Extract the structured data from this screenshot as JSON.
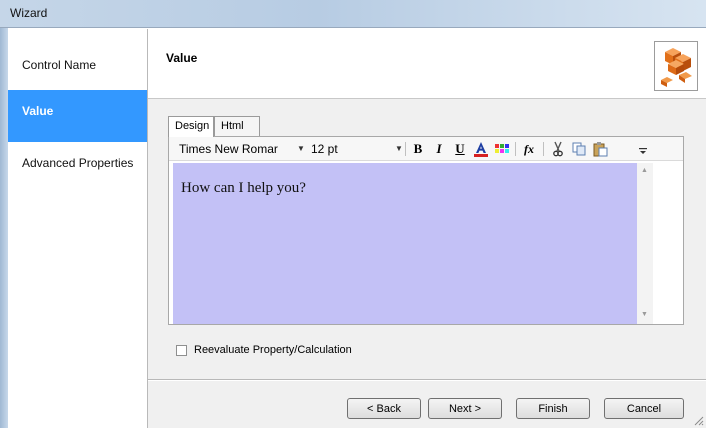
{
  "window": {
    "title": "Wizard"
  },
  "sidebar": {
    "items": [
      {
        "label": "Control Name",
        "active": false
      },
      {
        "label": "Value",
        "active": true
      },
      {
        "label": "Advanced Properties",
        "active": false
      }
    ]
  },
  "header": {
    "title": "Value",
    "logo_icon": "cubes-icon"
  },
  "tabs": [
    {
      "label": "Design",
      "active": true
    },
    {
      "label": "Html",
      "active": false
    }
  ],
  "toolbar": {
    "font": "Times New Romar",
    "size": "12 pt",
    "buttons": {
      "bold": "B",
      "italic": "I",
      "underline": "U",
      "formula": "fx"
    }
  },
  "editor": {
    "text": "How can I help you?"
  },
  "checkbox": {
    "label": "Reevaluate Property/Calculation",
    "checked": false
  },
  "buttons": {
    "back": "< Back",
    "next": "Next >",
    "finish": "Finish",
    "cancel": "Cancel"
  },
  "colors": {
    "accent": "#3398ff",
    "editor_bg": "#c3c1f6",
    "font_color_icon": "#d62020"
  }
}
